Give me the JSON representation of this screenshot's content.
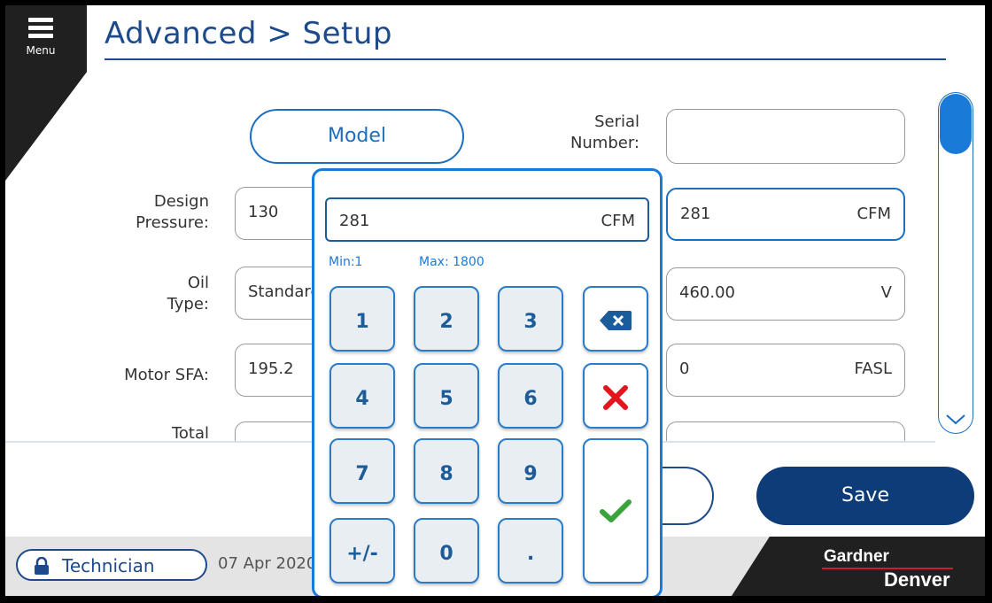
{
  "header": {
    "menu_label": "Menu",
    "title": "Advanced > Setup"
  },
  "form": {
    "model_button": "Model",
    "serial_label": "Serial\nNumber:",
    "serial_value": "",
    "design_pressure_label": "Design\nPressure:",
    "design_pressure_value": "130",
    "oil_type_label": "Oil\nType:",
    "oil_type_value": "Standard",
    "motor_sfa_label": "Motor SFA:",
    "motor_sfa_value": "195.2",
    "total_label": "Total",
    "flow_value": "281",
    "flow_unit": "CFM",
    "voltage_value": "460.00",
    "voltage_unit": "V",
    "altitude_value": "0",
    "altitude_unit": "FASL"
  },
  "keypad": {
    "display_value": "281",
    "display_unit": "CFM",
    "min_label": "Min:1",
    "max_label": "Max: 1800",
    "keys": [
      "1",
      "2",
      "3",
      "4",
      "5",
      "6",
      "7",
      "8",
      "9",
      "+/-",
      "0",
      "."
    ]
  },
  "actions": {
    "save_label": "Save"
  },
  "status": {
    "user_level": "Technician",
    "date": "07 Apr 2020"
  },
  "brand": {
    "line1": "Gardner",
    "line2": "Denver"
  },
  "colors": {
    "accent": "#1a7ad8",
    "title": "#1c4a8a",
    "save": "#0e3c78",
    "cancel_x": "#e3141b",
    "confirm": "#3aa33a"
  }
}
